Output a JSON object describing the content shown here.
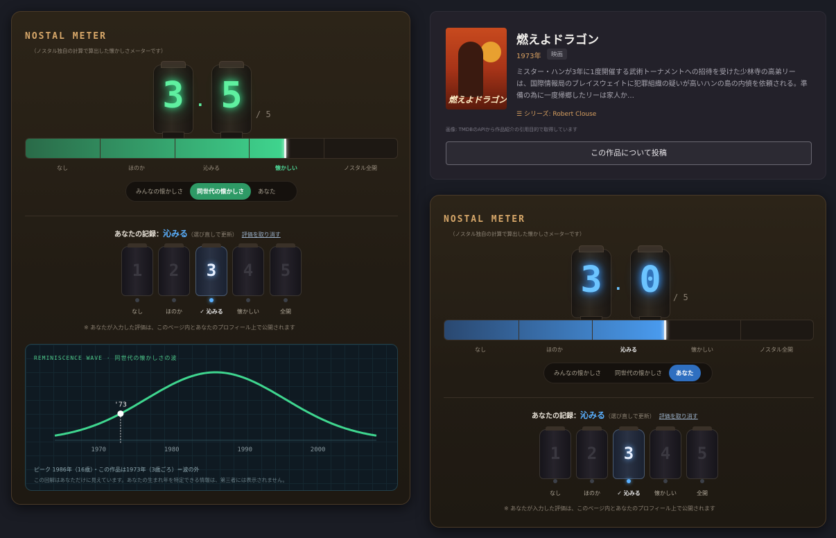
{
  "meter_left": {
    "title": "NOSTAL METER",
    "subtitle": "（ノスタル独自の計算で算出した懐かしさメーターです）",
    "digit1": "3",
    "digit2": "5",
    "dot": "·",
    "out_of": "/ 5",
    "score": 3.5,
    "accent_color": "#3fd68f",
    "bar_labels": [
      "なし",
      "ほのか",
      "沁みる",
      "懐かしい",
      "ノスタル全開"
    ],
    "active_bar_label_index": 3,
    "toggle": [
      "みんなの懐かしさ",
      "同世代の懐かしさ",
      "あなた"
    ],
    "toggle_active": 1,
    "record_label": "あなたの記録：",
    "record_value": "沁みる",
    "record_hint": "（選び直しで更新）",
    "record_undo": "評価を取り消す",
    "jars": [
      "1",
      "2",
      "3",
      "4",
      "5"
    ],
    "jar_labels": [
      "なし",
      "ほのか",
      "✓ 沁みる",
      "懐かしい",
      "全開"
    ],
    "jar_selected": 3,
    "public_note": "※ あなたが入力した評価は、このページ内とあなたのプロフィール上で公開されます",
    "wave": {
      "title": "REMINISCENCE WAVE · 同世代の懐かしさの波",
      "x_ticks": [
        "1970",
        "1980",
        "1990",
        "2000"
      ],
      "marker_label": "'73",
      "peak_year": 1986,
      "marker_year": 1973,
      "footer": "ピーク 1986年（16歳）・この作品は1973年（3歳ごろ）＝波の外",
      "privacy": "この回解はあなただけに見えています。あなたの生まれ年を特定できる情報は、第三者には表示されません。",
      "color": "#3fd68f"
    }
  },
  "film": {
    "title": "燃えよドラゴン",
    "year": "1973年",
    "type": "映画",
    "description": "ミスター・ハンが3年に1度開催する武術トーナメントへの招待を受けた少林寺の高弟リーは、国際情報局のブレイスウェイトに犯罪組織の疑いが高いハンの島の内偵を依頼される。準備の為に一度帰郷したリーは家人か…",
    "series": "シリーズ: Robert Clouse",
    "series_icon": "list-icon",
    "poster_text": "燃えよドラゴン",
    "credit": "画像: TMDBのAPIから作品紹介の引用目的で取得しています",
    "post_button": "この作品について投稿"
  },
  "meter_right": {
    "title": "NOSTAL METER",
    "subtitle": "（ノスタル独自の計算で算出した懐かしさメーターです）",
    "digit1": "3",
    "digit2": "0",
    "dot": "·",
    "out_of": "/ 5",
    "score": 3.0,
    "accent_color": "#4a9cf0",
    "bar_labels": [
      "なし",
      "ほのか",
      "沁みる",
      "懐かしい",
      "ノスタル全開"
    ],
    "active_bar_label_index": 2,
    "toggle": [
      "みんなの懐かしさ",
      "同世代の懐かしさ",
      "あなた"
    ],
    "toggle_active": 2,
    "record_label": "あなたの記録：",
    "record_value": "沁みる",
    "record_hint": "（選び直しで更新）",
    "record_undo": "評価を取り消す",
    "jars": [
      "1",
      "2",
      "3",
      "4",
      "5"
    ],
    "jar_labels": [
      "なし",
      "ほのか",
      "✓ 沁みる",
      "懐かしい",
      "全開"
    ],
    "jar_selected": 3,
    "public_note": "※ あなたが入力した評価は、このページ内とあなたのプロフィール上で公開されます"
  }
}
